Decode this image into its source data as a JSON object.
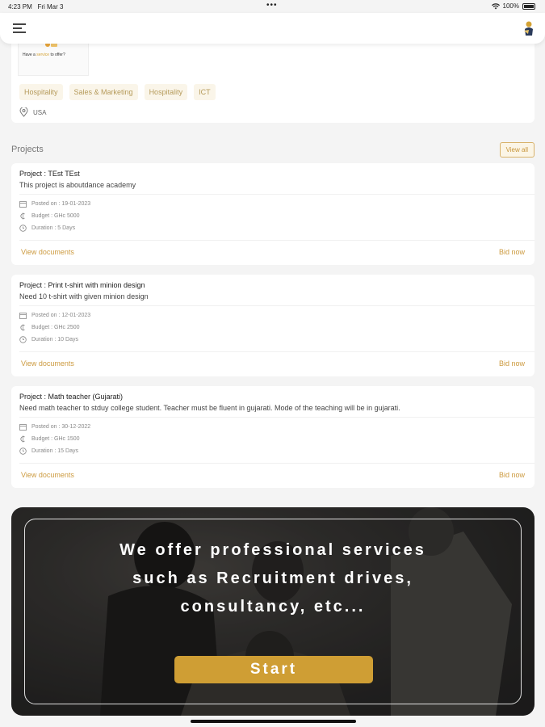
{
  "status_bar": {
    "time": "4:23 PM",
    "date": "Fri Mar 3",
    "dots": "•••",
    "battery": "100%"
  },
  "header": {
    "menu_icon": "hamburger-icon",
    "avatar_icon": "user-avatar"
  },
  "profile": {
    "thumb_title_prefix": "Have a ",
    "thumb_title_accent": "service",
    "thumb_title_suffix": " to offer?",
    "tags": [
      "Hospitality",
      "Sales & Marketing",
      "Hospitality",
      "ICT"
    ],
    "location": "USA"
  },
  "projects_section": {
    "title": "Projects",
    "view_all": "View all"
  },
  "projects": [
    {
      "title": "Project : TEst TEst",
      "description": "This project is aboutdance academy",
      "posted": "Posted on : 19-01-2023",
      "budget": "Budget : GHc 5000",
      "duration": "Duration : 5 Days",
      "view_documents": "View documents",
      "bid_now": "Bid now"
    },
    {
      "title": "Project : Print t-shirt with minion design",
      "description": "Need 10 t-shirt with given minion design",
      "posted": "Posted on : 12-01-2023",
      "budget": "Budget : GHc 2500",
      "duration": "Duration : 10 Days",
      "view_documents": "View documents",
      "bid_now": "Bid now"
    },
    {
      "title": "Project : Math teacher (Gujarati)",
      "description": "Need math teacher to stduy college student. Teacher must  be fluent in gujarati. Mode of the teaching will be in gujarati.",
      "posted": "Posted on : 30-12-2022",
      "budget": "Budget : GHc 1500",
      "duration": "Duration : 15 Days",
      "view_documents": "View documents",
      "bid_now": "Bid now"
    }
  ],
  "banner": {
    "line1": "We offer professional services",
    "line2": "such as Recruitment drives,",
    "line3": "consultancy, etc...",
    "start": "Start"
  },
  "colors": {
    "accent": "#cf9e34",
    "tag_bg": "#faf5e9",
    "link": "#cc9a3f"
  }
}
